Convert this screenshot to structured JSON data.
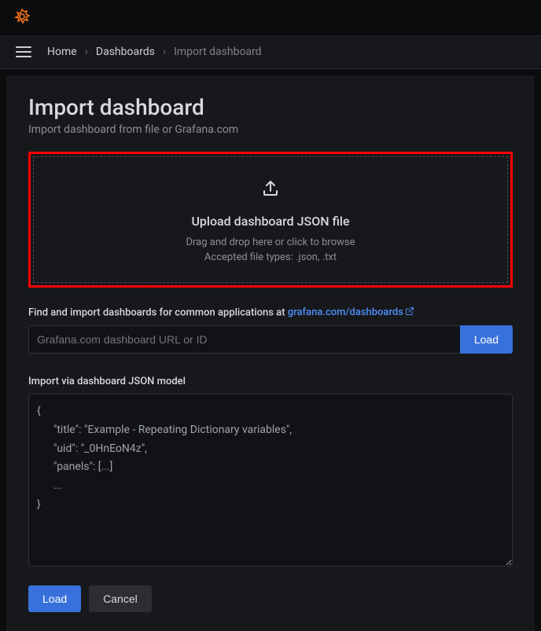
{
  "breadcrumb": {
    "home": "Home",
    "dashboards": "Dashboards",
    "current": "Import dashboard"
  },
  "page": {
    "title": "Import dashboard",
    "subtitle": "Import dashboard from file or Grafana.com"
  },
  "upload": {
    "title": "Upload dashboard JSON file",
    "hint": "Drag and drop here or click to browse",
    "filetypes": "Accepted file types: .json, .txt"
  },
  "grafana_section": {
    "label_prefix": "Find and import dashboards for common applications at ",
    "link_text": "grafana.com/dashboards",
    "input_placeholder": "Grafana.com dashboard URL or ID",
    "load_button": "Load"
  },
  "json_section": {
    "label": "Import via dashboard JSON model",
    "textarea_value": "{\n      \"title\": \"Example - Repeating Dictionary variables\",\n      \"uid\": \"_0HnEoN4z\",\n      \"panels\": [...]\n      ...\n}"
  },
  "actions": {
    "load": "Load",
    "cancel": "Cancel"
  }
}
